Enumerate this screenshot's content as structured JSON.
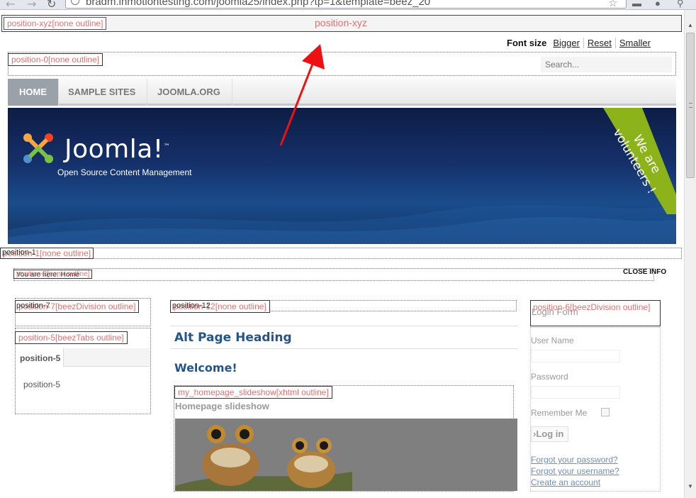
{
  "browser": {
    "url": "bradm.inmotiontesting.com/joomla25/index.php?tp=1&template=beez_20"
  },
  "positions": {
    "xyz_outline": "position-xyz[none outline]",
    "xyz_center": "position-xyz",
    "pos0_outline": "position-0[none outline]",
    "pos1_outline": "position-1[none outline]",
    "pos1_short": "position-1",
    "pos2_outline": "position-2[none outline]",
    "breadcrumb": "You are here: Home",
    "pos7_outline": "position-7[beezDivision outline]",
    "pos7_short": "position-7",
    "pos5_outline": "position-5[beezTabs outline]",
    "pos12_outline": "position-12[none outline]",
    "pos12_short": "position-12",
    "pos6_outline": "position-6[beezDivision outline]",
    "slideshow_outline": "my_homepage_slideshow[xhtml outline]"
  },
  "fontsize": {
    "label": "Font size",
    "bigger": "Bigger",
    "reset": "Reset",
    "smaller": "Smaller"
  },
  "search": {
    "placeholder": "Search..."
  },
  "menu": {
    "items": [
      {
        "label": "Home"
      },
      {
        "label": "Sample Sites"
      },
      {
        "label": "Joomla.org"
      }
    ]
  },
  "banner": {
    "logo_text": "Joomla!",
    "logo_tm": "™",
    "tagline": "Open Source Content Management",
    "ribbon_line1": "We are",
    "ribbon_line2": "volunteers !"
  },
  "close_info": "CLOSE INFO",
  "pos5": {
    "tab_label": "position-5",
    "content": "position-5"
  },
  "main": {
    "alt_heading": "Alt Page Heading",
    "welcome": "Welcome!",
    "slideshow_title": "Homepage slideshow"
  },
  "login": {
    "title": "Login Form",
    "username_label": "User Name",
    "password_label": "Password",
    "remember_label": "Remember Me",
    "button": "›Log in",
    "forgot_password": "Forgot your password?",
    "forgot_username": "Forgot your username?",
    "create_account": "Create an account"
  },
  "colors": {
    "heading": "#245589",
    "outline_label": "#e07070",
    "ribbon": "#8db31a"
  }
}
